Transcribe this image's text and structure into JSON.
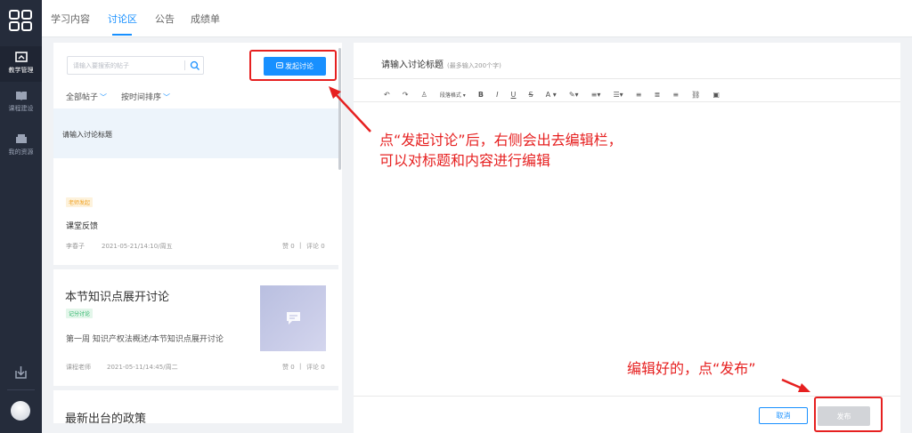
{
  "sidebar": {
    "items": [
      {
        "label": "教学管理",
        "icon": "teaching-icon",
        "active": true
      },
      {
        "label": "课程建设",
        "icon": "book-icon",
        "active": false
      },
      {
        "label": "我的资源",
        "icon": "box-icon",
        "active": false
      }
    ],
    "bottom_icons": [
      "export-icon",
      "avatar"
    ]
  },
  "topnav": {
    "tabs": [
      "学习内容",
      "讨论区",
      "公告",
      "成绩单"
    ],
    "active_tab": "讨论区"
  },
  "left_panel": {
    "search": {
      "placeholder": "请输入要搜索的帖子",
      "value": ""
    },
    "start_button": "发起讨论",
    "filters": {
      "category": "全部帖子",
      "sort": "按时间排序"
    },
    "draft_title": "请输入讨论标题",
    "posts": [
      {
        "badge": "老师发起",
        "title": "课堂反馈",
        "author": "李春子",
        "time": "2021-05-21/14:10/周五",
        "likes": "赞 0",
        "comments": "评论 0"
      },
      {
        "title": "本节知识点展开讨论",
        "badge": "记分讨论",
        "body": "第一周 知识产权法概述/本节知识点展开讨论",
        "author": "课程老师",
        "time": "2021-05-11/14:45/周二",
        "likes": "赞 0",
        "comments": "评论 0"
      },
      {
        "title": "最新出台的政策"
      }
    ]
  },
  "editor": {
    "title_placeholder": "请输入讨论标题",
    "title_hint": "(最多输入200个字)",
    "toolbar": {
      "paragraph": "段落格式",
      "bold": "B",
      "italic": "I",
      "underline": "U",
      "strike": "S",
      "font_color": "A",
      "ordered_list": "≡",
      "unordered_list": "☰"
    },
    "cancel": "取消",
    "publish": "发布"
  },
  "annotations": {
    "line1": "点“发起讨论”后，右侧会出去编辑栏，",
    "line2": "可以对标题和内容进行编辑",
    "publish_hint": "编辑好的，点“发布”"
  },
  "colors": {
    "accent": "#1890ff",
    "sidebar": "#252c3b",
    "annotation": "#e62020"
  }
}
